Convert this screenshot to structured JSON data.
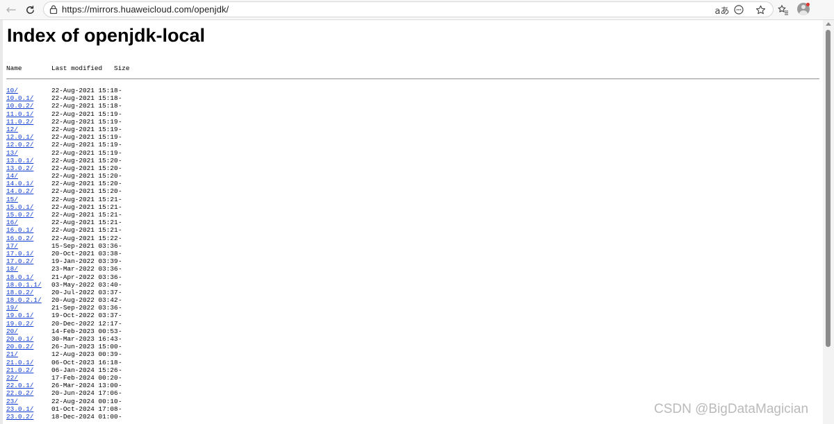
{
  "browser": {
    "url": "https://mirrors.huaweicloud.com/openjdk/",
    "read_aloud_label": "aあ"
  },
  "page": {
    "title": "Index of openjdk-local",
    "columns": {
      "name": "Name",
      "last_modified": "Last modified",
      "size": "Size"
    },
    "entries": [
      {
        "name": "10/",
        "modified": "22-Aug-2021 15:18",
        "size": "-"
      },
      {
        "name": "10.0.1/",
        "modified": "22-Aug-2021 15:18",
        "size": "-"
      },
      {
        "name": "10.0.2/",
        "modified": "22-Aug-2021 15:18",
        "size": "-"
      },
      {
        "name": "11.0.1/",
        "modified": "22-Aug-2021 15:19",
        "size": "-"
      },
      {
        "name": "11.0.2/",
        "modified": "22-Aug-2021 15:19",
        "size": "-"
      },
      {
        "name": "12/",
        "modified": "22-Aug-2021 15:19",
        "size": "-"
      },
      {
        "name": "12.0.1/",
        "modified": "22-Aug-2021 15:19",
        "size": "-"
      },
      {
        "name": "12.0.2/",
        "modified": "22-Aug-2021 15:19",
        "size": "-"
      },
      {
        "name": "13/",
        "modified": "22-Aug-2021 15:19",
        "size": "-"
      },
      {
        "name": "13.0.1/",
        "modified": "22-Aug-2021 15:20",
        "size": "-"
      },
      {
        "name": "13.0.2/",
        "modified": "22-Aug-2021 15:20",
        "size": "-"
      },
      {
        "name": "14/",
        "modified": "22-Aug-2021 15:20",
        "size": "-"
      },
      {
        "name": "14.0.1/",
        "modified": "22-Aug-2021 15:20",
        "size": "-"
      },
      {
        "name": "14.0.2/",
        "modified": "22-Aug-2021 15:20",
        "size": "-"
      },
      {
        "name": "15/",
        "modified": "22-Aug-2021 15:21",
        "size": "-"
      },
      {
        "name": "15.0.1/",
        "modified": "22-Aug-2021 15:21",
        "size": "-"
      },
      {
        "name": "15.0.2/",
        "modified": "22-Aug-2021 15:21",
        "size": "-"
      },
      {
        "name": "16/",
        "modified": "22-Aug-2021 15:21",
        "size": "-"
      },
      {
        "name": "16.0.1/",
        "modified": "22-Aug-2021 15:21",
        "size": "-"
      },
      {
        "name": "16.0.2/",
        "modified": "22-Aug-2021 15:22",
        "size": "-"
      },
      {
        "name": "17/",
        "modified": "15-Sep-2021 03:36",
        "size": "-"
      },
      {
        "name": "17.0.1/",
        "modified": "20-Oct-2021 03:38",
        "size": "-"
      },
      {
        "name": "17.0.2/",
        "modified": "19-Jan-2022 03:39",
        "size": "-"
      },
      {
        "name": "18/",
        "modified": "23-Mar-2022 03:36",
        "size": "-"
      },
      {
        "name": "18.0.1/",
        "modified": "21-Apr-2022 03:36",
        "size": "-"
      },
      {
        "name": "18.0.1.1/",
        "modified": "03-May-2022 03:40",
        "size": "-"
      },
      {
        "name": "18.0.2/",
        "modified": "20-Jul-2022 03:37",
        "size": "-"
      },
      {
        "name": "18.0.2.1/",
        "modified": "20-Aug-2022 03:42",
        "size": "-"
      },
      {
        "name": "19/",
        "modified": "21-Sep-2022 03:36",
        "size": "-"
      },
      {
        "name": "19.0.1/",
        "modified": "19-Oct-2022 03:37",
        "size": "-"
      },
      {
        "name": "19.0.2/",
        "modified": "20-Dec-2022 12:17",
        "size": "-"
      },
      {
        "name": "20/",
        "modified": "14-Feb-2023 00:53",
        "size": "-"
      },
      {
        "name": "20.0.1/",
        "modified": "30-Mar-2023 16:43",
        "size": "-"
      },
      {
        "name": "20.0.2/",
        "modified": "26-Jun-2023 15:00",
        "size": "-"
      },
      {
        "name": "21/",
        "modified": "12-Aug-2023 00:39",
        "size": "-"
      },
      {
        "name": "21.0.1/",
        "modified": "06-Oct-2023 16:18",
        "size": "-"
      },
      {
        "name": "21.0.2/",
        "modified": "06-Jan-2024 15:26",
        "size": "-"
      },
      {
        "name": "22/",
        "modified": "17-Feb-2024 00:20",
        "size": "-"
      },
      {
        "name": "22.0.1/",
        "modified": "26-Mar-2024 13:00",
        "size": "-"
      },
      {
        "name": "22.0.2/",
        "modified": "20-Jun-2024 17:06",
        "size": "-"
      },
      {
        "name": "23/",
        "modified": "22-Aug-2024 00:10",
        "size": "-"
      },
      {
        "name": "23.0.1/",
        "modified": "01-Oct-2024 17:08",
        "size": "-"
      },
      {
        "name": "23.0.2/",
        "modified": "18-Dec-2024 01:00",
        "size": "-"
      }
    ]
  },
  "watermark": "CSDN @BigDataMagician",
  "icons": {
    "back": "back-arrow-icon",
    "reload": "reload-icon",
    "lock": "lock-icon",
    "read_aloud": "read-aloud-icon",
    "emoji": "emoji-icon",
    "favorite": "star-icon",
    "favorites_list": "favorites-list-icon",
    "profile": "profile-avatar-icon"
  },
  "colors": {
    "link": "#0b3bd3",
    "notification": "#e0312b"
  }
}
